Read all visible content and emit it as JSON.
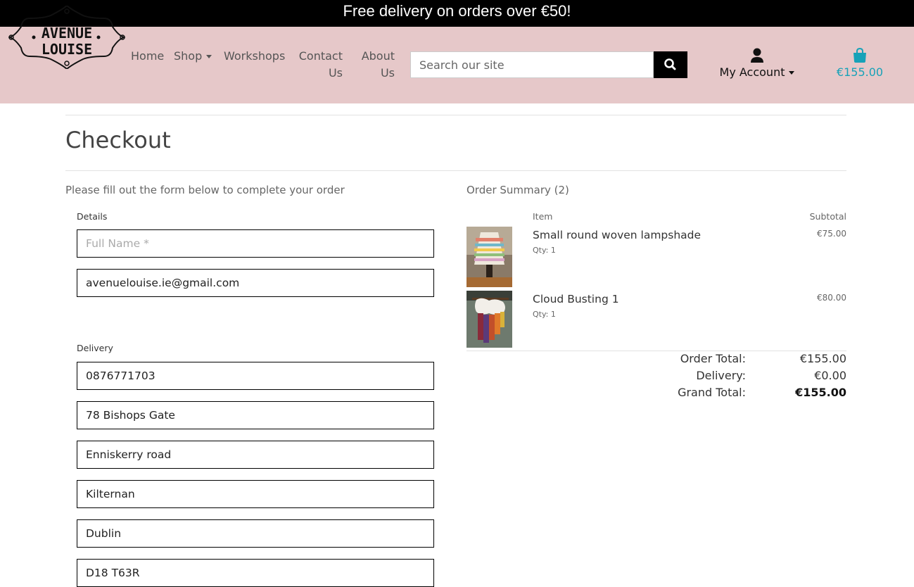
{
  "banner": {
    "text": "Free delivery on orders over €50!"
  },
  "logo": {
    "line1": "AVENUE",
    "line2": "LOUISE"
  },
  "nav": {
    "home": "Home",
    "shop": "Shop",
    "workshops": "Workshops",
    "contact_l1": "Contact",
    "contact_l2": "Us",
    "about_l1": "About",
    "about_l2": "Us"
  },
  "search": {
    "placeholder": "Search our site",
    "icon": "search-icon"
  },
  "account": {
    "label": "My Account",
    "icon": "user-icon"
  },
  "cart": {
    "total": "€155.00",
    "icon": "shopping-bag-icon",
    "color": "#17a2b8"
  },
  "page": {
    "title": "Checkout",
    "form_intro": "Please fill out the form below to complete your order"
  },
  "form": {
    "details_label": "Details",
    "full_name_placeholder": "Full Name *",
    "email_value": "avenuelouise.ie@gmail.com",
    "delivery_label": "Delivery",
    "phone_value": "0876771703",
    "address1_value": "78 Bishops Gate",
    "address2_value": "Enniskerry road",
    "town_value": "Kilternan",
    "county_value": "Dublin",
    "postcode_value": "D18 T63R"
  },
  "summary": {
    "heading": "Order Summary (2)",
    "col_item": "Item",
    "col_subtotal": "Subtotal",
    "items": [
      {
        "name": "Small round woven lampshade",
        "qty": "Qty: 1",
        "subtotal": "€75.00"
      },
      {
        "name": "Cloud Busting 1",
        "qty": "Qty: 1",
        "subtotal": "€80.00"
      }
    ],
    "order_total_label": "Order Total:",
    "order_total": "€155.00",
    "delivery_label": "Delivery:",
    "delivery": "€0.00",
    "grand_total_label": "Grand Total:",
    "grand_total": "€155.00"
  },
  "colors": {
    "header_bg": "#e6c8c9",
    "banner_bg": "#000000",
    "accent": "#17a2b8"
  }
}
